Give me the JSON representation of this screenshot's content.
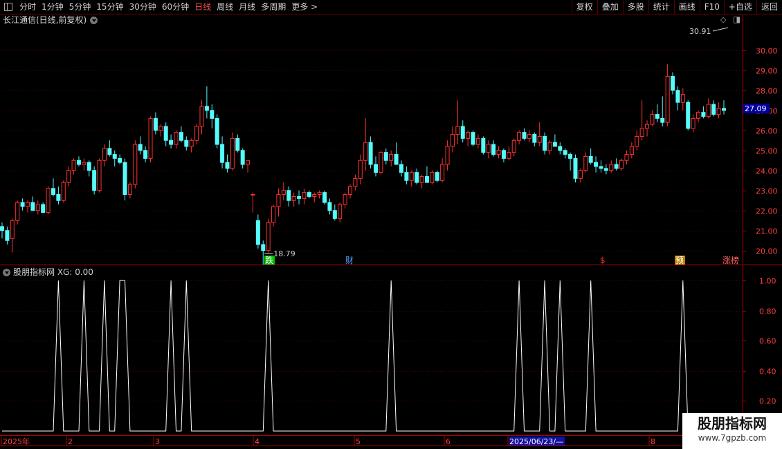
{
  "toolbar": {
    "left_items": [
      "分时",
      "1分钟",
      "5分钟",
      "15分钟",
      "30分钟",
      "60分钟",
      "日线",
      "周线",
      "月线",
      "多周期",
      "更多 >"
    ],
    "active": "日线",
    "right_items": [
      "复权",
      "叠加",
      "多股",
      "统计",
      "画线",
      "F10",
      "+自选",
      "返回"
    ]
  },
  "title": "长江通信(日线,前复权)",
  "sub_title": "股朋指标网 XG: 0.00",
  "price_axis": [
    "30.00",
    "29.00",
    "28.00",
    "27.00",
    "26.00",
    "25.00",
    "24.00",
    "23.00",
    "22.00",
    "21.00",
    "20.00"
  ],
  "current_price": "27.09",
  "annotations": {
    "high": "30.91",
    "low": "18.79"
  },
  "events": [
    "跌",
    "财",
    "$",
    "预",
    "涨榜"
  ],
  "date_axis": [
    "2025年",
    "2",
    "3",
    "4",
    "5",
    "6",
    "2025/06/23/—",
    "8"
  ],
  "indicator_axis": [
    "1.00",
    "0.80",
    "0.60",
    "0.40",
    "0.20"
  ],
  "colors": {
    "up": "#ff3232",
    "down": "#54fcfc",
    "frame": "#b00000",
    "signal": "#ffffff"
  },
  "chart_data": {
    "type": "candlestick",
    "y_range": [
      19.3,
      31.2
    ],
    "ohlc": [
      [
        21.2,
        21.4,
        20.6,
        21.0
      ],
      [
        21.0,
        21.2,
        20.3,
        20.5
      ],
      [
        20.6,
        21.6,
        19.9,
        21.5
      ],
      [
        21.5,
        22.5,
        21.3,
        22.4
      ],
      [
        22.4,
        22.6,
        22.0,
        22.2
      ],
      [
        22.2,
        22.5,
        21.9,
        22.4
      ],
      [
        22.4,
        22.7,
        22.1,
        22.0
      ],
      [
        22.0,
        22.5,
        21.8,
        22.3
      ],
      [
        22.3,
        22.4,
        21.9,
        21.9
      ],
      [
        21.9,
        23.2,
        21.8,
        23.1
      ],
      [
        23.1,
        23.6,
        22.7,
        22.8
      ],
      [
        22.8,
        23.2,
        22.3,
        22.5
      ],
      [
        22.5,
        23.5,
        22.4,
        23.4
      ],
      [
        23.4,
        24.2,
        23.2,
        24.0
      ],
      [
        24.0,
        24.6,
        23.8,
        24.5
      ],
      [
        24.5,
        24.7,
        24.2,
        24.3
      ],
      [
        24.3,
        24.6,
        24.0,
        24.4
      ],
      [
        24.4,
        24.5,
        23.7,
        24.0
      ],
      [
        24.0,
        24.2,
        22.8,
        23.0
      ],
      [
        23.0,
        24.6,
        22.9,
        24.5
      ],
      [
        24.5,
        25.3,
        24.2,
        25.1
      ],
      [
        25.1,
        25.5,
        24.7,
        24.8
      ],
      [
        24.8,
        25.0,
        24.2,
        24.6
      ],
      [
        24.6,
        24.8,
        24.3,
        24.4
      ],
      [
        24.4,
        24.6,
        22.5,
        22.8
      ],
      [
        22.8,
        23.4,
        22.6,
        23.3
      ],
      [
        23.3,
        25.5,
        23.1,
        25.3
      ],
      [
        25.3,
        25.7,
        24.8,
        25.0
      ],
      [
        25.0,
        25.2,
        24.4,
        24.6
      ],
      [
        24.6,
        26.7,
        24.4,
        26.6
      ],
      [
        26.6,
        26.9,
        25.8,
        26.0
      ],
      [
        26.0,
        26.3,
        25.7,
        26.2
      ],
      [
        26.2,
        26.4,
        25.2,
        25.5
      ],
      [
        25.5,
        25.8,
        25.1,
        25.3
      ],
      [
        25.3,
        26.0,
        25.1,
        25.9
      ],
      [
        25.9,
        26.2,
        25.4,
        25.5
      ],
      [
        25.5,
        25.7,
        25.0,
        25.2
      ],
      [
        25.2,
        25.6,
        24.9,
        25.5
      ],
      [
        25.5,
        26.3,
        25.3,
        26.2
      ],
      [
        26.2,
        27.5,
        25.8,
        27.2
      ],
      [
        27.2,
        28.2,
        26.6,
        27.0
      ],
      [
        27.0,
        27.3,
        26.1,
        26.6
      ],
      [
        26.6,
        26.8,
        25.1,
        25.3
      ],
      [
        25.3,
        25.7,
        24.1,
        24.4
      ],
      [
        24.4,
        24.8,
        23.9,
        24.1
      ],
      [
        24.1,
        25.9,
        24.0,
        25.6
      ],
      [
        25.6,
        25.8,
        24.9,
        25.0
      ],
      [
        25.0,
        25.1,
        24.1,
        24.3
      ],
      [
        24.3,
        24.4,
        23.9,
        24.5
      ],
      [
        22.8,
        22.9,
        21.9,
        22.8
      ],
      [
        21.5,
        21.8,
        20.1,
        20.3
      ],
      [
        20.3,
        20.5,
        19.3,
        20.0
      ],
      [
        20.0,
        21.6,
        19.9,
        21.4
      ],
      [
        21.4,
        22.3,
        21.2,
        22.2
      ],
      [
        22.2,
        23.1,
        21.7,
        22.8
      ],
      [
        22.8,
        23.4,
        22.5,
        23.0
      ],
      [
        23.0,
        23.2,
        22.2,
        22.5
      ],
      [
        22.5,
        22.9,
        22.2,
        22.7
      ],
      [
        22.7,
        23.0,
        22.3,
        22.6
      ],
      [
        22.6,
        23.1,
        22.3,
        22.9
      ],
      [
        22.9,
        23.0,
        22.6,
        22.7
      ],
      [
        22.7,
        22.9,
        22.4,
        22.8
      ],
      [
        22.8,
        23.0,
        22.6,
        22.9
      ],
      [
        22.9,
        23.0,
        22.3,
        22.4
      ],
      [
        22.4,
        22.6,
        21.8,
        22.0
      ],
      [
        22.0,
        22.3,
        21.5,
        21.6
      ],
      [
        21.6,
        22.4,
        21.4,
        22.3
      ],
      [
        22.3,
        22.9,
        22.1,
        22.8
      ],
      [
        22.8,
        23.3,
        22.6,
        23.2
      ],
      [
        23.2,
        23.8,
        23.0,
        23.6
      ],
      [
        23.6,
        24.8,
        23.3,
        24.5
      ],
      [
        24.5,
        26.6,
        24.0,
        25.4
      ],
      [
        25.4,
        25.7,
        24.1,
        24.3
      ],
      [
        24.3,
        24.7,
        23.7,
        23.9
      ],
      [
        23.9,
        25.0,
        23.8,
        24.9
      ],
      [
        24.9,
        25.1,
        24.3,
        24.5
      ],
      [
        24.5,
        25.0,
        24.2,
        24.8
      ],
      [
        24.8,
        25.4,
        24.6,
        24.3
      ],
      [
        24.3,
        24.5,
        23.7,
        23.9
      ],
      [
        23.9,
        24.2,
        23.3,
        23.5
      ],
      [
        23.5,
        24.0,
        23.2,
        23.9
      ],
      [
        23.9,
        24.1,
        23.3,
        23.4
      ],
      [
        23.4,
        23.8,
        23.1,
        23.7
      ],
      [
        23.7,
        24.2,
        23.4,
        23.4
      ],
      [
        23.4,
        24.0,
        23.3,
        23.9
      ],
      [
        23.9,
        24.0,
        23.4,
        23.5
      ],
      [
        23.5,
        24.6,
        23.4,
        24.3
      ],
      [
        24.3,
        25.5,
        24.0,
        25.2
      ],
      [
        25.2,
        26.2,
        24.9,
        25.8
      ],
      [
        25.8,
        27.5,
        25.3,
        26.2
      ],
      [
        26.2,
        26.5,
        25.4,
        25.6
      ],
      [
        25.6,
        26.0,
        25.2,
        25.9
      ],
      [
        25.9,
        26.0,
        25.2,
        25.3
      ],
      [
        25.3,
        25.8,
        25.1,
        25.6
      ],
      [
        25.6,
        25.7,
        24.8,
        24.9
      ],
      [
        24.9,
        25.5,
        24.6,
        25.3
      ],
      [
        25.3,
        25.5,
        24.7,
        24.8
      ],
      [
        24.8,
        25.2,
        24.6,
        25.0
      ],
      [
        25.0,
        25.1,
        24.4,
        24.6
      ],
      [
        24.6,
        25.2,
        24.5,
        24.9
      ],
      [
        24.9,
        25.6,
        24.7,
        25.5
      ],
      [
        25.5,
        26.0,
        25.3,
        25.9
      ],
      [
        25.9,
        26.1,
        25.5,
        25.6
      ],
      [
        25.6,
        26.0,
        25.4,
        25.8
      ],
      [
        25.8,
        25.9,
        25.2,
        25.4
      ],
      [
        25.4,
        26.4,
        25.2,
        25.7
      ],
      [
        25.7,
        25.9,
        24.8,
        25.0
      ],
      [
        25.0,
        25.5,
        24.8,
        25.4
      ],
      [
        25.4,
        25.8,
        25.2,
        25.2
      ],
      [
        25.2,
        25.4,
        24.8,
        25.0
      ],
      [
        25.0,
        25.1,
        24.6,
        24.8
      ],
      [
        24.8,
        24.9,
        24.0,
        24.6
      ],
      [
        24.6,
        24.8,
        23.4,
        23.6
      ],
      [
        23.6,
        24.1,
        23.4,
        24.0
      ],
      [
        24.0,
        24.9,
        23.9,
        24.7
      ],
      [
        24.7,
        25.1,
        24.3,
        24.4
      ],
      [
        24.4,
        24.7,
        23.9,
        24.2
      ],
      [
        24.2,
        24.5,
        23.9,
        24.1
      ],
      [
        24.1,
        24.3,
        23.8,
        24.0
      ],
      [
        24.0,
        24.5,
        23.9,
        24.3
      ],
      [
        24.3,
        24.6,
        24.0,
        24.1
      ],
      [
        24.1,
        24.6,
        24.0,
        24.5
      ],
      [
        24.5,
        25.0,
        24.3,
        24.8
      ],
      [
        24.8,
        25.4,
        24.6,
        25.2
      ],
      [
        25.2,
        26.0,
        25.0,
        25.7
      ],
      [
        25.7,
        27.5,
        25.5,
        26.1
      ],
      [
        26.1,
        26.5,
        25.7,
        26.3
      ],
      [
        26.3,
        27.0,
        26.2,
        26.8
      ],
      [
        26.8,
        27.3,
        26.4,
        26.6
      ],
      [
        26.6,
        27.7,
        26.2,
        26.4
      ],
      [
        26.4,
        29.3,
        26.2,
        28.7
      ],
      [
        28.7,
        28.9,
        27.8,
        28.0
      ],
      [
        28.0,
        28.2,
        27.0,
        27.4
      ],
      [
        27.4,
        28.1,
        27.0,
        27.8
      ],
      [
        27.4,
        27.5,
        26.0,
        26.1
      ],
      [
        26.1,
        26.8,
        25.9,
        26.6
      ],
      [
        26.6,
        27.0,
        26.4,
        26.9
      ],
      [
        26.9,
        27.2,
        26.6,
        26.7
      ],
      [
        26.7,
        27.6,
        26.6,
        27.3
      ],
      [
        27.3,
        27.5,
        26.7,
        26.8
      ],
      [
        26.8,
        27.4,
        26.6,
        27.1
      ],
      [
        27.1,
        27.5,
        26.8,
        27.0
      ]
    ],
    "signal_indices": [
      11,
      16,
      20,
      23,
      24,
      33,
      36,
      52,
      76,
      101,
      106,
      109,
      115,
      133
    ]
  }
}
